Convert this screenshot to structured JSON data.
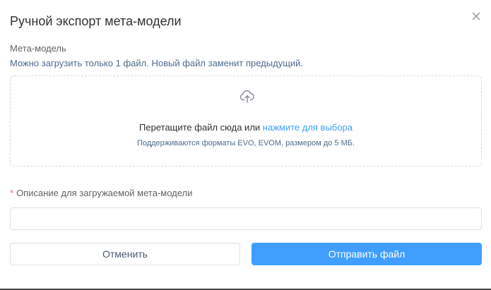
{
  "dialog": {
    "title": "Ручной экспорт мета-модели",
    "close_icon": "close-icon"
  },
  "upload": {
    "label": "Мета-модель",
    "hint": "Можно загрузить только 1 файл. Новый файл заменит предыдущий.",
    "icon": "cloud-upload-icon",
    "drop_text": "Перетащите файл сюда или ",
    "drop_link": "нажмите для выбора",
    "formats_text": "Поддерживаются форматы EVO, EVOM, размером до 5 МБ."
  },
  "description": {
    "required_mark": "*",
    "label": "Описание для загружаемой мета-модели",
    "value": "",
    "placeholder": ""
  },
  "actions": {
    "cancel_label": "Отменить",
    "submit_label": "Отправить файл"
  },
  "colors": {
    "accent": "#409eff",
    "required": "#f56c6c",
    "hint": "#4f6b8a"
  }
}
